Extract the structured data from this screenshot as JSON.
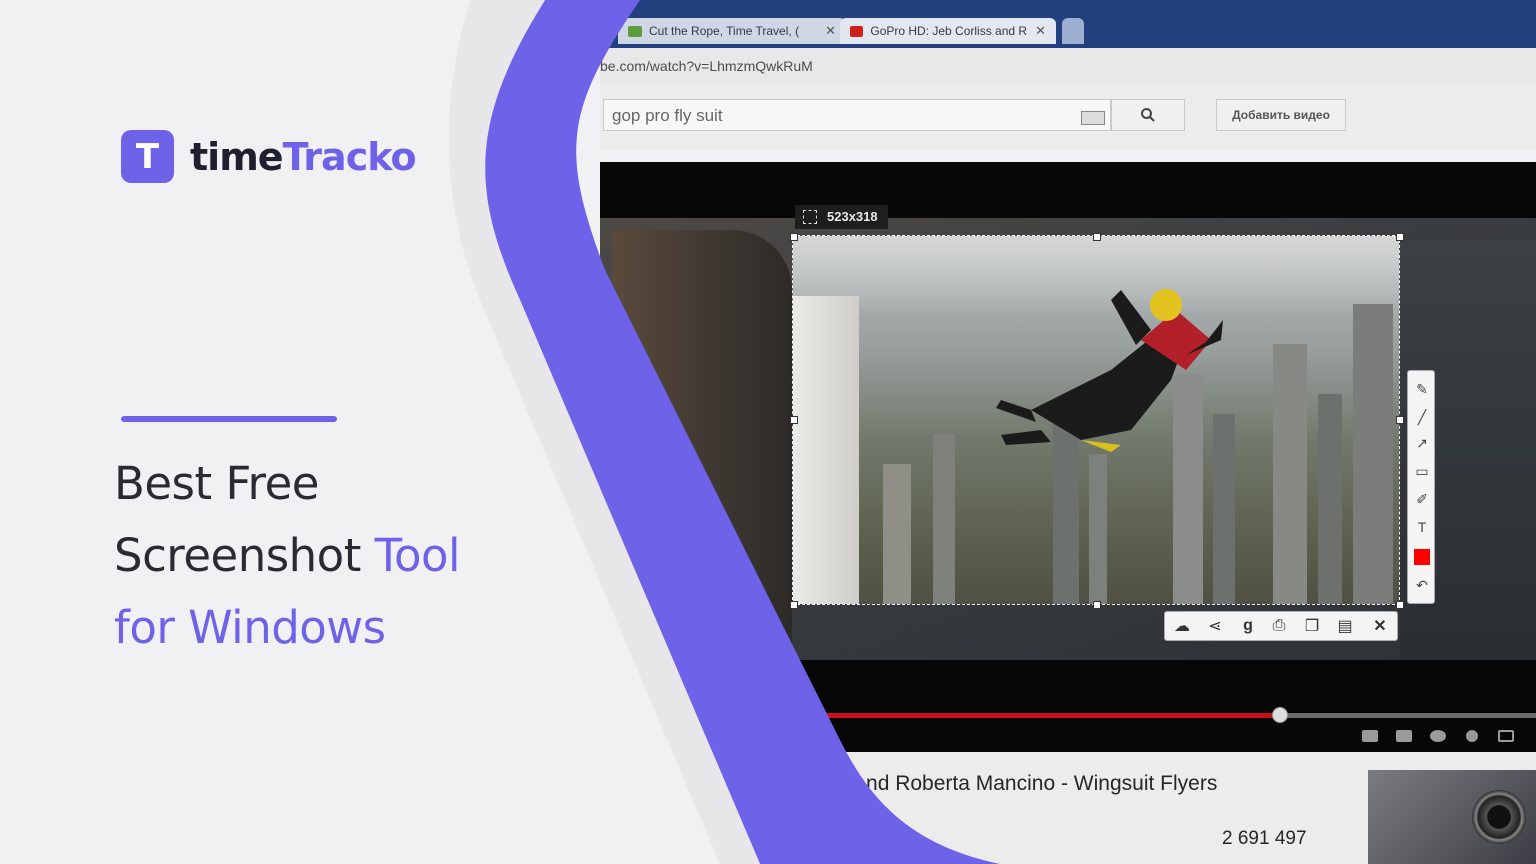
{
  "brand": {
    "mark_letter": "T",
    "name_part1": "time",
    "name_part2": "Tracko"
  },
  "headline": {
    "line1": "Best Free",
    "line2_plain": "Screenshot ",
    "line2_accent": "Tool",
    "line3": "for Windows"
  },
  "colors": {
    "accent": "#6e63e8",
    "text": "#2a2a33",
    "panel": "#f1f1f3"
  },
  "browser": {
    "tabs": [
      {
        "label": "Cut the Rope, Time Travel, (",
        "icon": "game-icon"
      },
      {
        "label": "GoPro HD: Jeb Corliss and R",
        "icon": "youtube-icon"
      }
    ],
    "address": "be.com/watch?v=LhmzmQwkRuM"
  },
  "youtube": {
    "search_value": "gop pro fly suit",
    "upload_label": "Добавить видео"
  },
  "capture": {
    "size_label": "523x318",
    "vertical_tools": [
      "pencil-icon",
      "line-icon",
      "arrow-icon",
      "rectangle-icon",
      "marker-icon",
      "text-icon",
      "color-swatch",
      "undo-icon"
    ],
    "horizontal_tools": [
      "upload-cloud-icon",
      "share-icon",
      "google-search-icon",
      "print-icon",
      "copy-icon",
      "save-icon",
      "close-icon"
    ],
    "color": "#ff0000"
  },
  "video": {
    "title": "s and Roberta Mancino - Wingsuit Flyers",
    "views": "2 691 497",
    "progress": 0.67
  }
}
